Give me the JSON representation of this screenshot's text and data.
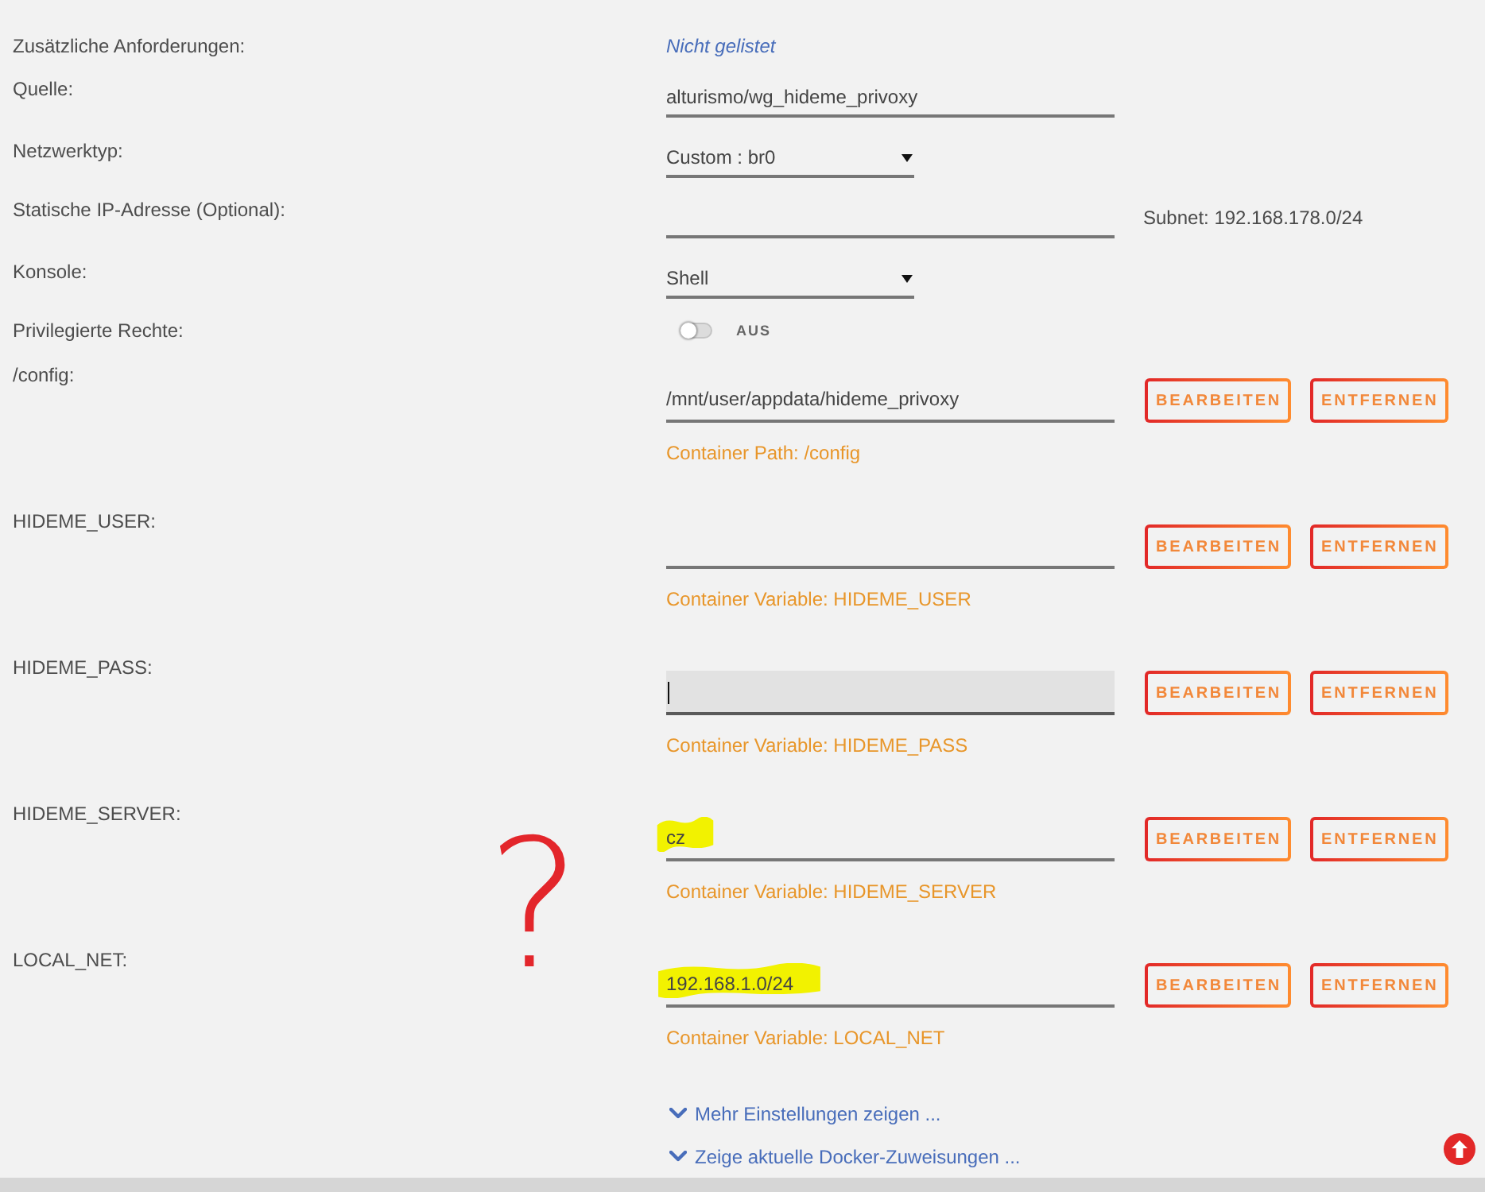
{
  "settings": [
    {
      "kind": "info",
      "label": "Zusätzliche Anforderungen:",
      "value": "Nicht gelistet"
    },
    {
      "kind": "text",
      "label": "Quelle:",
      "value": "alturismo/wg_hideme_privoxy"
    },
    {
      "kind": "select",
      "label": "Netzwerktyp:",
      "value": "Custom : br0"
    },
    {
      "kind": "text",
      "label": "Statische IP-Adresse (Optional):",
      "note": "Subnet: 192.168.178.0/24"
    },
    {
      "kind": "select",
      "label": "Konsole:",
      "value": "Shell"
    },
    {
      "kind": "toggle",
      "label": "Privilegierte Rechte:",
      "on": false,
      "state_label": "AUS"
    }
  ],
  "config_entries": [
    {
      "label": "/config:",
      "value": "/mnt/user/appdata/hideme_privoxy",
      "focused": false,
      "highlighted": false,
      "description": "Container Path: /config",
      "buttons": [
        "BEARBEITEN",
        "ENTFERNEN"
      ]
    },
    {
      "label": "HIDEME_USER:",
      "focused": false,
      "highlighted": false,
      "description": "Container Variable: HIDEME_USER",
      "buttons": [
        "BEARBEITEN",
        "ENTFERNEN"
      ]
    },
    {
      "label": "HIDEME_PASS:",
      "focused": true,
      "highlighted": false,
      "description": "Container Variable: HIDEME_PASS",
      "buttons": [
        "BEARBEITEN",
        "ENTFERNEN"
      ]
    },
    {
      "label": "HIDEME_SERVER:",
      "value": "cz",
      "focused": false,
      "highlighted": true,
      "description": "Container Variable: HIDEME_SERVER",
      "buttons": [
        "BEARBEITEN",
        "ENTFERNEN"
      ]
    },
    {
      "label": "LOCAL_NET:",
      "value": "192.168.1.0/24",
      "focused": false,
      "highlighted": true,
      "description": "Container Variable: LOCAL_NET",
      "buttons": [
        "BEARBEITEN",
        "ENTFERNEN"
      ]
    }
  ],
  "links": [
    {
      "label": "Mehr Einstellungen zeigen ..."
    },
    {
      "label": "Zeige aktuelle Docker-Zuweisungen ..."
    }
  ],
  "annotation": {
    "text": "?"
  }
}
